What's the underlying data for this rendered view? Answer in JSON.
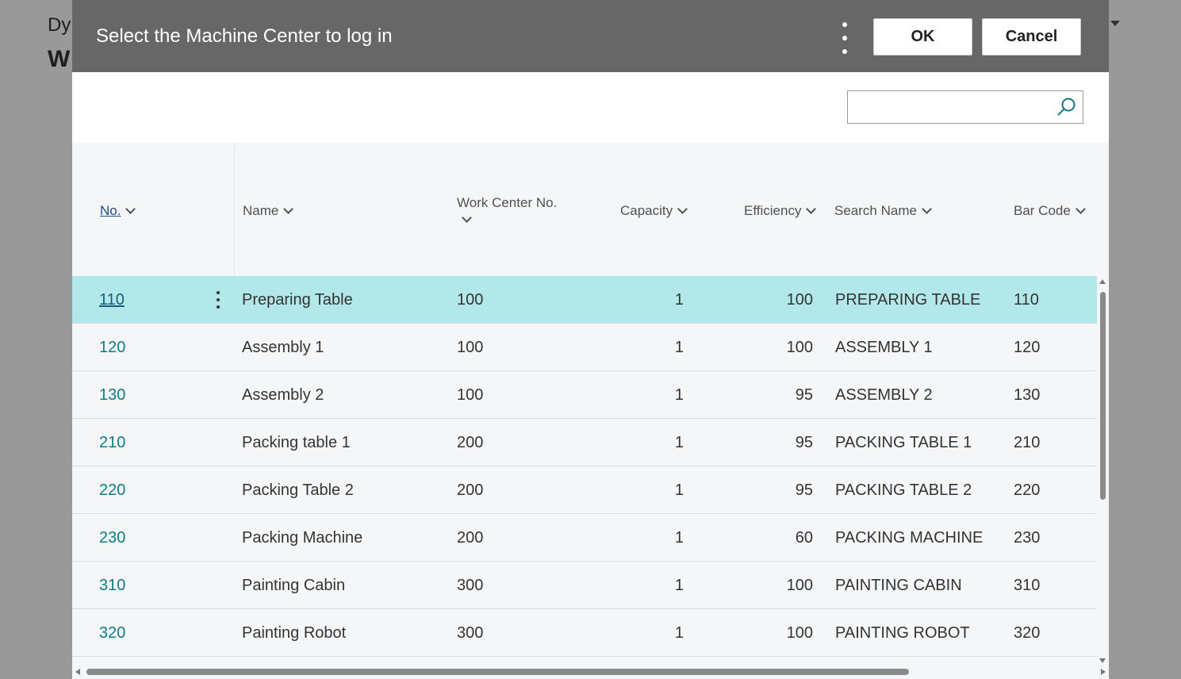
{
  "background": {
    "line1": "Dy",
    "line2": "W"
  },
  "dialog": {
    "title": "Select the Machine Center to log in",
    "ok_label": "OK",
    "cancel_label": "Cancel",
    "more_icon": "more-vertical-icon"
  },
  "search": {
    "value": "",
    "placeholder": "",
    "icon": "search-icon"
  },
  "colors": {
    "header_bg": "#676767",
    "selected_row": "#b2e8ea",
    "link": "#0f7b84"
  },
  "table": {
    "columns": [
      {
        "key": "no",
        "label": "No."
      },
      {
        "key": "name",
        "label": "Name"
      },
      {
        "key": "wc",
        "label": "Work Center No."
      },
      {
        "key": "cap",
        "label": "Capacity"
      },
      {
        "key": "eff",
        "label": "Efficiency"
      },
      {
        "key": "sn",
        "label": "Search Name"
      },
      {
        "key": "bc",
        "label": "Bar Code"
      }
    ],
    "rows": [
      {
        "no": "110",
        "name": "Preparing Table",
        "wc": "100",
        "cap": "1",
        "eff": "100",
        "sn": "PREPARING TABLE",
        "bc": "110",
        "selected": true
      },
      {
        "no": "120",
        "name": "Assembly 1",
        "wc": "100",
        "cap": "1",
        "eff": "100",
        "sn": "ASSEMBLY 1",
        "bc": "120"
      },
      {
        "no": "130",
        "name": "Assembly 2",
        "wc": "100",
        "cap": "1",
        "eff": "95",
        "sn": "ASSEMBLY 2",
        "bc": "130"
      },
      {
        "no": "210",
        "name": "Packing table 1",
        "wc": "200",
        "cap": "1",
        "eff": "95",
        "sn": "PACKING TABLE 1",
        "bc": "210"
      },
      {
        "no": "220",
        "name": "Packing Table 2",
        "wc": "200",
        "cap": "1",
        "eff": "95",
        "sn": "PACKING TABLE 2",
        "bc": "220"
      },
      {
        "no": "230",
        "name": "Packing Machine",
        "wc": "200",
        "cap": "1",
        "eff": "60",
        "sn": "PACKING MACHINE",
        "bc": "230"
      },
      {
        "no": "310",
        "name": "Painting Cabin",
        "wc": "300",
        "cap": "1",
        "eff": "100",
        "sn": "PAINTING CABIN",
        "bc": "310"
      },
      {
        "no": "320",
        "name": "Painting Robot",
        "wc": "300",
        "cap": "1",
        "eff": "100",
        "sn": "PAINTING ROBOT",
        "bc": "320"
      }
    ]
  }
}
